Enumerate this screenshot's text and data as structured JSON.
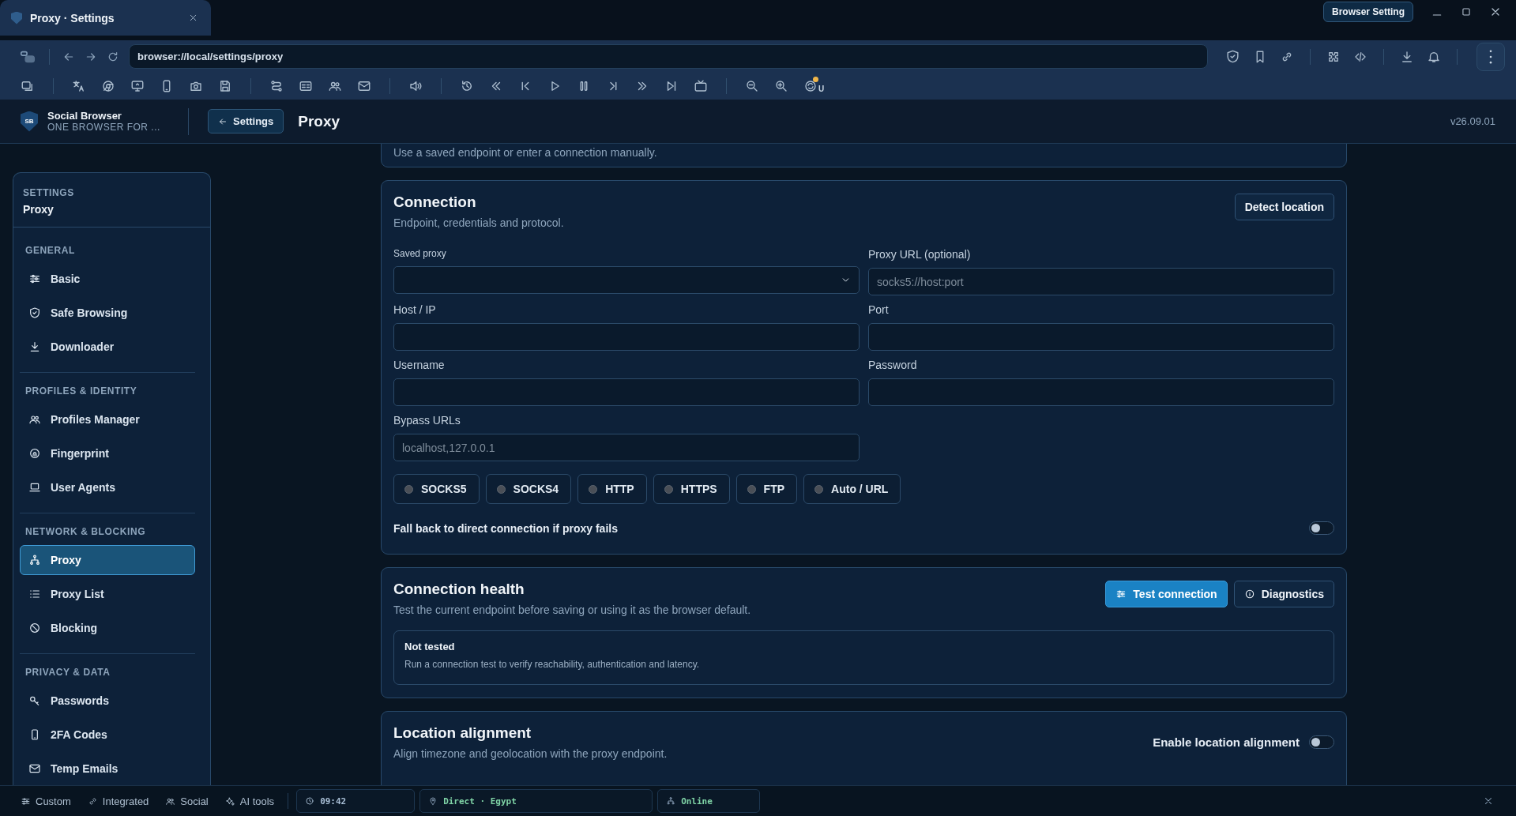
{
  "window": {
    "tab_title": "Proxy · Settings",
    "tooltip": "Browser Setting"
  },
  "address_bar": {
    "url": "browser://local/settings/proxy"
  },
  "toolbar": {
    "badge_letter": "U"
  },
  "app_header": {
    "logo_text": "SB",
    "brand": "Social Browser",
    "tagline": "ONE BROWSER FOR ...",
    "back_button": "Settings",
    "page_title": "Proxy",
    "version": "v26.09.01"
  },
  "sidebar": {
    "label": "SETTINGS",
    "current": "Proxy",
    "sections": [
      {
        "title": "GENERAL",
        "items": [
          {
            "label": "Basic",
            "selected": false
          },
          {
            "label": "Safe Browsing",
            "selected": false
          },
          {
            "label": "Downloader",
            "selected": false
          }
        ]
      },
      {
        "title": "PROFILES & IDENTITY",
        "items": [
          {
            "label": "Profiles Manager",
            "selected": false
          },
          {
            "label": "Fingerprint",
            "selected": false
          },
          {
            "label": "User Agents",
            "selected": false
          }
        ]
      },
      {
        "title": "NETWORK & BLOCKING",
        "items": [
          {
            "label": "Proxy",
            "selected": true
          },
          {
            "label": "Proxy List",
            "selected": false
          },
          {
            "label": "Blocking",
            "selected": false
          }
        ]
      },
      {
        "title": "PRIVACY & DATA",
        "items": [
          {
            "label": "Passwords",
            "selected": false
          },
          {
            "label": "2FA Codes",
            "selected": false
          },
          {
            "label": "Temp Emails",
            "selected": false
          }
        ]
      }
    ]
  },
  "intro_card": {
    "subtitle": "Use a saved endpoint or enter a connection manually."
  },
  "connection": {
    "title": "Connection",
    "subtitle": "Endpoint, credentials and protocol.",
    "action": "Detect location",
    "fields": [
      {
        "label": "Saved proxy",
        "kind": "select"
      },
      {
        "label": "Proxy URL (optional)",
        "kind": "text",
        "placeholder": "socks5://host:port"
      },
      {
        "label": "Host / IP",
        "kind": "text"
      },
      {
        "label": "Port",
        "kind": "text"
      },
      {
        "label": "Username",
        "kind": "text"
      },
      {
        "label": "Password",
        "kind": "text"
      },
      {
        "label": "Bypass URLs",
        "kind": "text",
        "placeholder": "localhost,127.0.0.1"
      }
    ],
    "protocols": [
      {
        "label": "SOCKS5",
        "selected": false
      },
      {
        "label": "SOCKS4",
        "selected": false
      },
      {
        "label": "HTTP",
        "selected": false
      },
      {
        "label": "HTTPS",
        "selected": false
      },
      {
        "label": "FTP",
        "selected": false
      },
      {
        "label": "Auto / URL",
        "selected": false
      }
    ],
    "fallback": {
      "label": "Fall back to direct connection if proxy fails",
      "on": false
    }
  },
  "health": {
    "title": "Connection health",
    "subtitle": "Test the current endpoint before saving or using it as the browser default.",
    "buttons": [
      {
        "label": "Test connection",
        "kind": "primary"
      },
      {
        "label": "Diagnostics",
        "kind": "secondary"
      }
    ],
    "status": {
      "title": "Not tested",
      "description": "Run a connection test to verify reachability, authentication and latency."
    }
  },
  "location": {
    "title": "Location alignment",
    "subtitle": "Align timezone and geolocation with the proxy endpoint.",
    "toggle": {
      "label": "Enable location alignment",
      "on": false
    }
  },
  "status_bar": {
    "modes": [
      "Custom",
      "Integrated",
      "Social",
      "AI tools"
    ],
    "time": "09:42",
    "location": "Direct · Egypt",
    "network": "Online"
  }
}
